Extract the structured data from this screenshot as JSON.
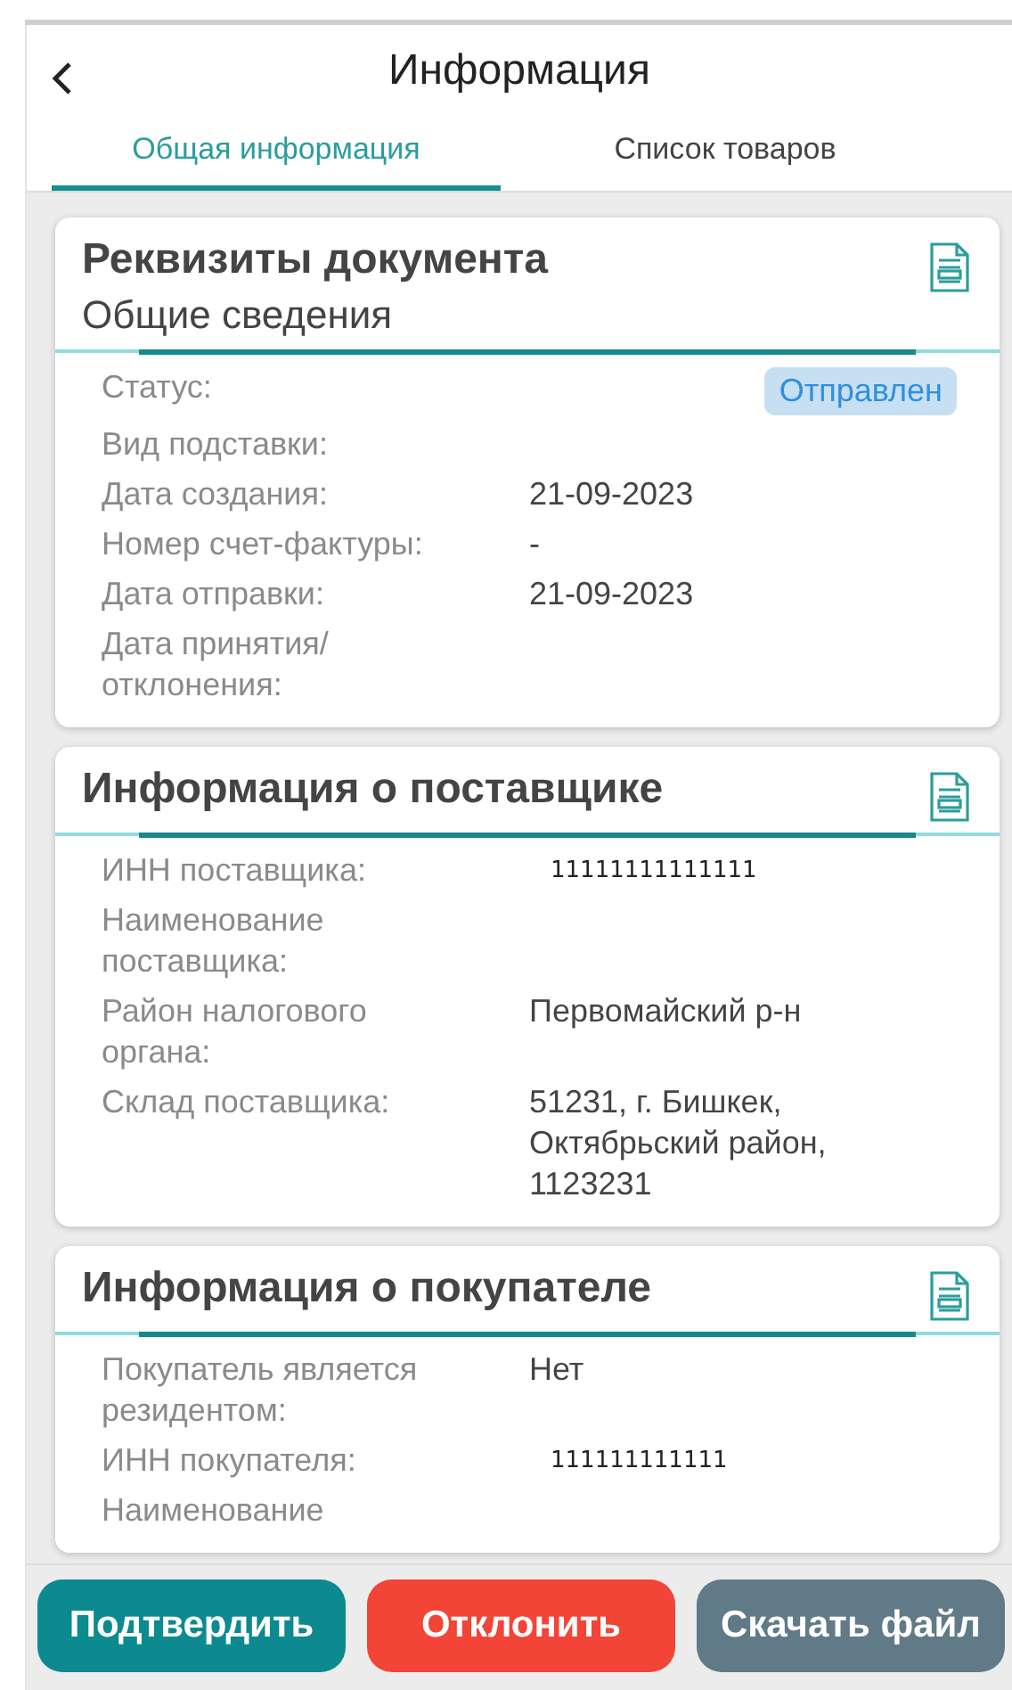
{
  "header": {
    "title": "Информация"
  },
  "tabs": [
    {
      "label": "Общая информация",
      "selected": true
    },
    {
      "label": "Список товаров",
      "selected": false
    }
  ],
  "cards": [
    {
      "title": "Реквизиты документа",
      "subtitle": "Общие сведения",
      "rows": [
        {
          "label": "Статус:",
          "value": "Отправлен",
          "kind": "badge"
        },
        {
          "label": "Вид подставки:"
        },
        {
          "label": "Дата создания:",
          "value": "21-09-2023",
          "kind": "text"
        },
        {
          "label": "Номер счет-фактуры:",
          "value": "-",
          "kind": "text"
        },
        {
          "label": "Дата отправки:",
          "value": "21-09-2023",
          "kind": "text"
        },
        {
          "label": "Дата принятия/ отклонения:"
        }
      ]
    },
    {
      "title": "Информация о поставщике",
      "rows": [
        {
          "label": "ИНН поставщика:",
          "value": "11111111111111",
          "kind": "code"
        },
        {
          "label": "Наименование поставщика:"
        },
        {
          "label": "Район налогового органа:",
          "value": "Первомайский р-н",
          "kind": "text"
        },
        {
          "label": "Склад поставщика:",
          "value": "51231, г. Бишкек, Октябрьский район, 1123231",
          "kind": "text"
        }
      ]
    },
    {
      "title": "Информация о покупателе",
      "rows": [
        {
          "label": "Покупатель является резидентом:",
          "value": "Нет",
          "kind": "text"
        },
        {
          "label": "ИНН покупателя:",
          "value": "111111111111",
          "kind": "code"
        },
        {
          "label": "Наименование"
        }
      ]
    }
  ],
  "buttons": [
    {
      "label": "Подтвердить",
      "kind": "confirm"
    },
    {
      "label": "Отклонить",
      "kind": "reject"
    },
    {
      "label": "Скачать файл",
      "kind": "download"
    }
  ]
}
